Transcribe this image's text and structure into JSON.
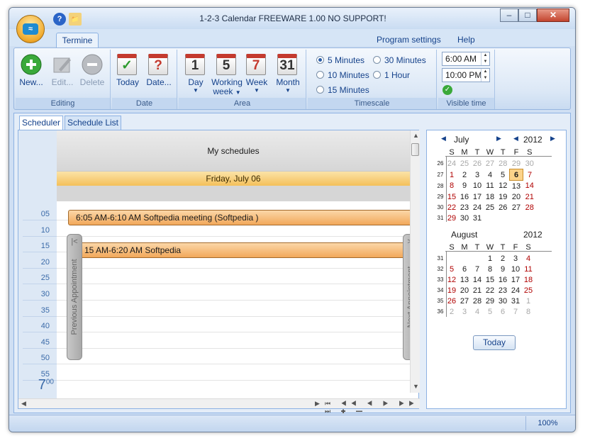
{
  "window": {
    "title": "1-2-3 Calendar FREEWARE 1.00 NO SUPPORT!",
    "buttons": {
      "minimize": "–",
      "maximize": "□",
      "close": "✕"
    }
  },
  "quick_access": {
    "help": "?",
    "folder": "📁"
  },
  "ribbon": {
    "tab": "Termine",
    "menu": [
      "Program settings",
      "Help"
    ],
    "groups": {
      "editing": {
        "label": "Editing",
        "new": "New...",
        "edit": "Edit...",
        "delete": "Delete"
      },
      "date": {
        "label": "Date",
        "today": "Today",
        "date": "Date..."
      },
      "area": {
        "label": "Area",
        "day": "Day",
        "working_week_1": "Working",
        "working_week_2": "week",
        "week": "Week",
        "month": "Month",
        "day_num": "1",
        "week_num": "5",
        "wk_num": "7",
        "month_num": "31"
      },
      "timescale": {
        "label": "Timescale",
        "options": [
          "5 Minutes",
          "30 Minutes",
          "10 Minutes",
          "1 Hour",
          "15 Minutes"
        ],
        "selected": "5 Minutes"
      },
      "visible_time": {
        "label": "Visible time",
        "start": "6:00 AM",
        "end": "10:00 PM"
      }
    }
  },
  "view_tabs": [
    "Scheduler",
    "Schedule List"
  ],
  "scheduler": {
    "header": "My schedules",
    "day": "Friday, July 06",
    "time_labels": [
      "05",
      "10",
      "15",
      "20",
      "25",
      "30",
      "35",
      "40",
      "45",
      "50",
      "55"
    ],
    "hour_label": "7",
    "hour_minutes": "00",
    "appointments": [
      "6:05 AM-6:10 AM Softpedia meeting (Softpedia )",
      "15 AM-6:20 AM Softpedia"
    ],
    "prev_label": "Previous Appointment",
    "next_label": "Next Appointment"
  },
  "mini_calendar": {
    "weekdays": [
      "S",
      "M",
      "T",
      "W",
      "T",
      "F",
      "S"
    ],
    "months": [
      {
        "name": "July",
        "year": "2012",
        "weeks": [
          {
            "wk": "26",
            "days": [
              "24",
              "25",
              "26",
              "27",
              "28",
              "29",
              "30"
            ],
            "out": [
              true,
              true,
              true,
              true,
              true,
              true,
              true
            ]
          },
          {
            "wk": "27",
            "days": [
              "1",
              "2",
              "3",
              "4",
              "5",
              "6",
              "7"
            ],
            "out": [
              false,
              false,
              false,
              false,
              false,
              false,
              false
            ]
          },
          {
            "wk": "28",
            "days": [
              "8",
              "9",
              "10",
              "11",
              "12",
              "13",
              "14"
            ],
            "out": [
              false,
              false,
              false,
              false,
              false,
              false,
              false
            ]
          },
          {
            "wk": "29",
            "days": [
              "15",
              "16",
              "17",
              "18",
              "19",
              "20",
              "21"
            ],
            "out": [
              false,
              false,
              false,
              false,
              false,
              false,
              false
            ]
          },
          {
            "wk": "30",
            "days": [
              "22",
              "23",
              "24",
              "25",
              "26",
              "27",
              "28"
            ],
            "out": [
              false,
              false,
              false,
              false,
              false,
              false,
              false
            ]
          },
          {
            "wk": "31",
            "days": [
              "29",
              "30",
              "31",
              "",
              "",
              "",
              ""
            ],
            "out": [
              false,
              false,
              false,
              false,
              false,
              false,
              false
            ]
          }
        ],
        "selected": "6"
      },
      {
        "name": "August",
        "year": "2012",
        "weeks": [
          {
            "wk": "31",
            "days": [
              "",
              "",
              "",
              "1",
              "2",
              "3",
              "4"
            ],
            "out": [
              false,
              false,
              false,
              false,
              false,
              false,
              false
            ]
          },
          {
            "wk": "32",
            "days": [
              "5",
              "6",
              "7",
              "8",
              "9",
              "10",
              "11"
            ],
            "out": [
              false,
              false,
              false,
              false,
              false,
              false,
              false
            ]
          },
          {
            "wk": "33",
            "days": [
              "12",
              "13",
              "14",
              "15",
              "16",
              "17",
              "18"
            ],
            "out": [
              false,
              false,
              false,
              false,
              false,
              false,
              false
            ]
          },
          {
            "wk": "34",
            "days": [
              "19",
              "20",
              "21",
              "22",
              "23",
              "24",
              "25"
            ],
            "out": [
              false,
              false,
              false,
              false,
              false,
              false,
              false
            ]
          },
          {
            "wk": "35",
            "days": [
              "26",
              "27",
              "28",
              "29",
              "30",
              "31",
              "1"
            ],
            "out": [
              false,
              false,
              false,
              false,
              false,
              false,
              true
            ]
          },
          {
            "wk": "36",
            "days": [
              "2",
              "3",
              "4",
              "5",
              "6",
              "7",
              "8"
            ],
            "out": [
              true,
              true,
              true,
              true,
              true,
              true,
              true
            ]
          }
        ],
        "selected": ""
      }
    ],
    "today_button": "Today"
  },
  "statusbar": {
    "zoom": "100%"
  },
  "colors": {
    "accent": "#15428b",
    "appointment": "#f2a85a",
    "day_header": "#f4c05a",
    "weekend": "#b00000"
  }
}
